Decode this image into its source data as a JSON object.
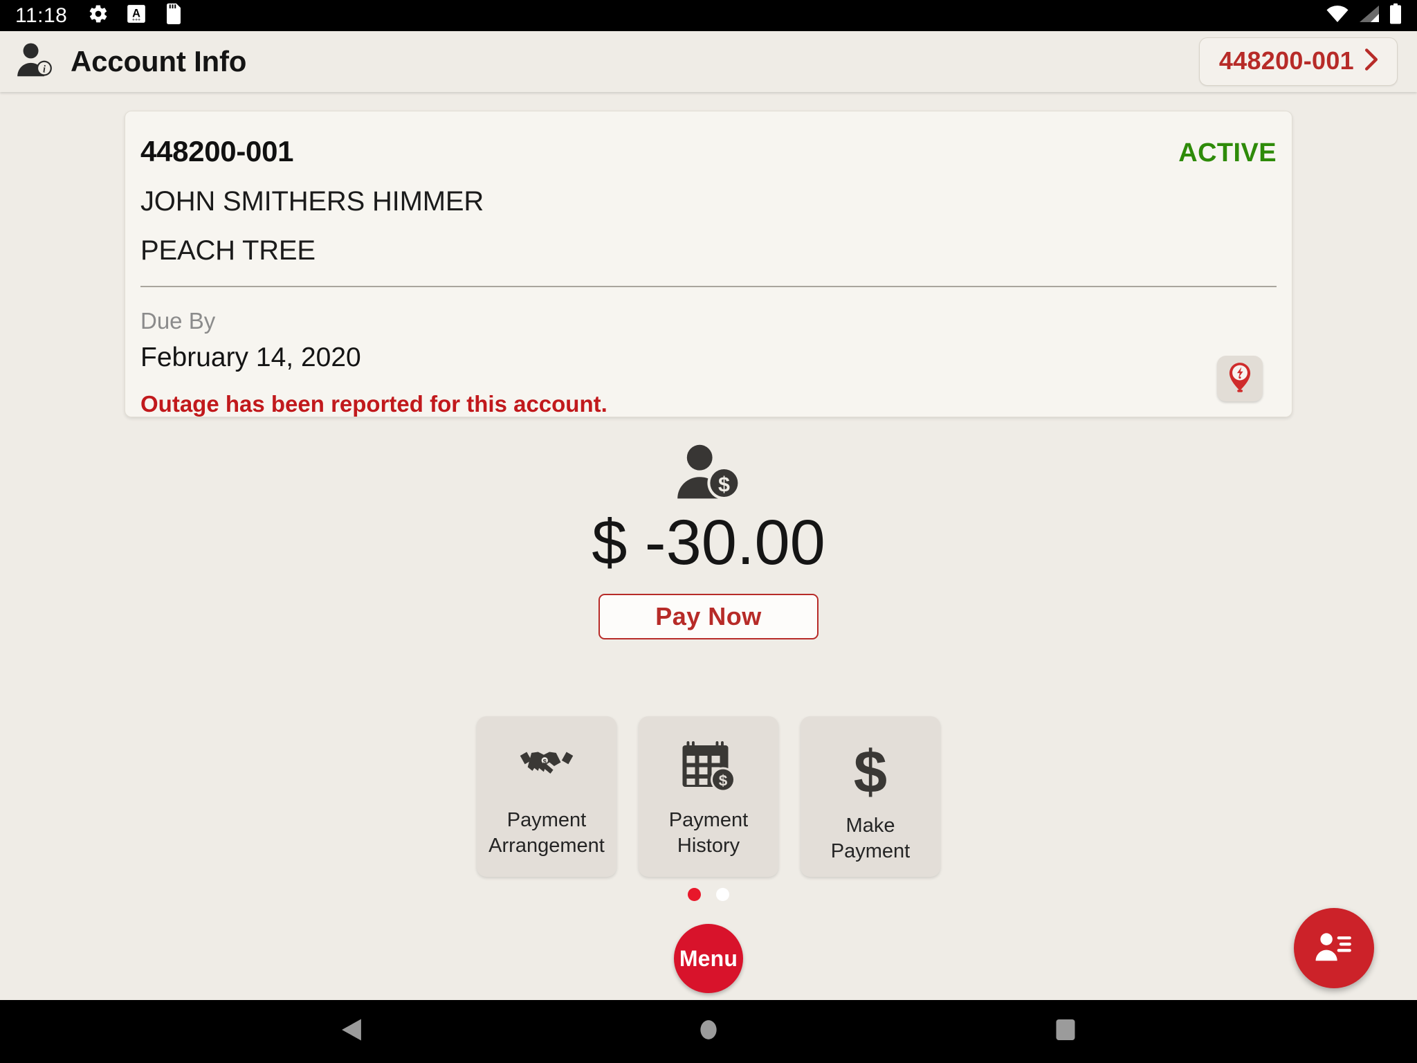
{
  "statusbar": {
    "time": "11:18",
    "left_icons": [
      "gear-icon",
      "font-size-a-icon",
      "sd-card-icon"
    ],
    "right_icons": [
      "wifi-icon",
      "cellular-signal-icon",
      "battery-icon"
    ]
  },
  "appbar": {
    "icon": "account-info-icon",
    "title": "Account Info",
    "account_pill": {
      "label": "448200-001",
      "chevron": "chevron-right-icon",
      "color": "#b72b28"
    }
  },
  "account_card": {
    "account_number": "448200-001",
    "status": "ACTIVE",
    "status_color": "#2e8b09",
    "customer_name": "JOHN SMITHERS HIMMER",
    "customer_address": "PEACH TREE",
    "due_label": "Due By",
    "due_date": "February 14, 2020",
    "outage_message": "Outage has been reported for this account.",
    "outage_message_color": "#c1191c",
    "outage_button_icon": "outage-pin-icon"
  },
  "balance": {
    "icon": "customer-balance-icon",
    "amount": "$ -30.00",
    "pay_now_label": "Pay Now",
    "pay_now_color": "#b72b28"
  },
  "tiles": [
    {
      "icon": "handshake-icon",
      "label_line1": "Payment",
      "label_line2": "Arrangement"
    },
    {
      "icon": "calendar-dollar-icon",
      "label_line1": "Payment",
      "label_line2": "History"
    },
    {
      "icon": "dollar-sign-icon",
      "label_line1": "Make Payment",
      "label_line2": ""
    }
  ],
  "pager": {
    "total": 2,
    "active_index": 0,
    "active_color": "#e8172a",
    "inactive_color": "#ffffff"
  },
  "menu_button": {
    "label": "Menu",
    "color": "#d8132b"
  },
  "contacts_fab": {
    "icon": "contact-list-icon",
    "color": "#cc2229"
  },
  "navbar": {
    "back": "back-triangle-icon",
    "home": "home-circle-icon",
    "recents": "recents-square-icon"
  }
}
